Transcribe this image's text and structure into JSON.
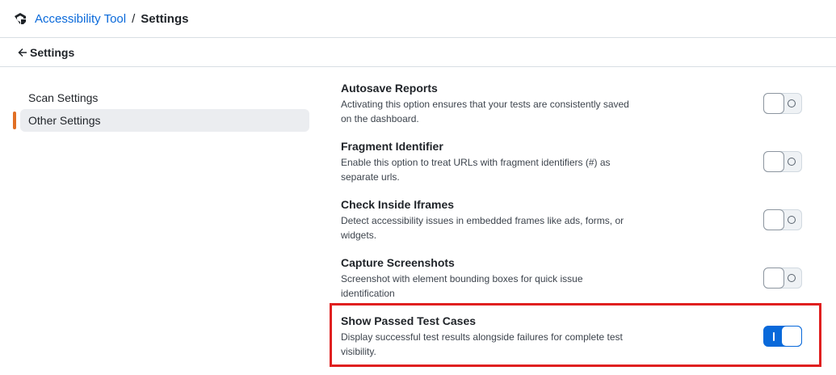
{
  "header": {
    "app_name": "Accessibility Tool",
    "separator": "/",
    "current_page": "Settings"
  },
  "subheader": {
    "back_icon": "arrow-left-icon",
    "title": "Settings"
  },
  "sidebar": {
    "items": [
      {
        "label": "Scan Settings",
        "active": false
      },
      {
        "label": "Other Settings",
        "active": true
      }
    ]
  },
  "settings": {
    "items": [
      {
        "title": "Autosave Reports",
        "description": "Activating this option ensures that your tests are consistently saved on the dashboard.",
        "enabled": false
      },
      {
        "title": "Fragment Identifier",
        "description": "Enable this option to treat URLs with fragment identifiers (#) as separate urls.",
        "enabled": false
      },
      {
        "title": "Check Inside Iframes",
        "description": "Detect accessibility issues in embedded frames like ads, forms, or widgets.",
        "enabled": false
      },
      {
        "title": "Capture Screenshots",
        "description": "Screenshot with element bounding boxes for quick issue identification",
        "enabled": false
      },
      {
        "title": "Show Passed Test Cases",
        "description": "Display successful test results alongside failures for complete test visibility.",
        "enabled": true,
        "highlighted": true
      }
    ]
  },
  "colors": {
    "link": "#0969da",
    "accent_indicator": "#e16f24",
    "toggle_on": "#0969da",
    "highlight": "#e02020"
  }
}
